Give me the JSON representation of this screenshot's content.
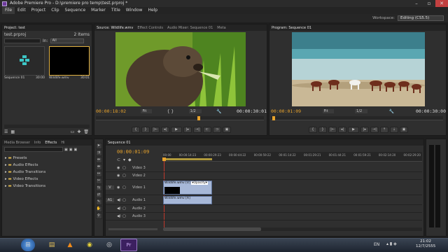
{
  "window": {
    "title": "Adobe Premiere Pro - D:\\premiere pro temp\\test.prproj *"
  },
  "menu": [
    "File",
    "Edit",
    "Project",
    "Clip",
    "Sequence",
    "Marker",
    "Title",
    "Window",
    "Help"
  ],
  "workspace": {
    "label": "Workspace:",
    "value": "Editing (CS5.5)"
  },
  "project_panel": {
    "tab": "Project: test",
    "file": "test.prproj",
    "count": "2 Items",
    "in_label": "In:",
    "in_value": "All",
    "items": [
      {
        "name": "Sequence 01",
        "duration": "30:00"
      },
      {
        "name": "Wildlife.wmv",
        "duration": "30:01"
      }
    ]
  },
  "source_monitor": {
    "tabs": [
      "Source: Wildlife.wmv",
      "Effect Controls",
      "Audio Mixer: Sequence 01",
      "Meta"
    ],
    "timecode_left": "00:00:18:02",
    "fit": "Fit",
    "ratio": "1/2",
    "timecode_right": "00:00:30:01"
  },
  "program_monitor": {
    "tab": "Program: Sequence 01",
    "timecode_left": "00:00:01:09",
    "fit": "Fit",
    "ratio": "1/2",
    "timecode_right": "00:00:30:00"
  },
  "effects_panel": {
    "tabs": [
      "Media Browser",
      "Info",
      "Effects",
      "Hi"
    ],
    "folders": [
      "Presets",
      "Audio Effects",
      "Audio Transitions",
      "Video Effects",
      "Video Transitions"
    ]
  },
  "timeline": {
    "tab": "Sequence 01",
    "timecode": "00:00:01:09",
    "ruler": [
      "00:00",
      "00:00:14:23",
      "00:00:29:23",
      "00:00:44:22",
      "00:00:59:22",
      "00:01:14:22",
      "00:01:29:21",
      "00:01:44:21",
      "00:01:59:21",
      "00:02:14:20",
      "00:02:29:20"
    ],
    "tracks": [
      {
        "patch": "",
        "name": "Video 3"
      },
      {
        "patch": "",
        "name": "Video 2"
      },
      {
        "patch": "V",
        "name": "Video 1"
      },
      {
        "patch": "A1",
        "name": "Audio 1"
      },
      {
        "patch": "",
        "name": "Audio 2"
      },
      {
        "patch": "",
        "name": "Audio 3"
      }
    ],
    "video_clip": "Wildlife.wmv [V]",
    "video_clip_fx": "Opacity",
    "audio_clip": "Wildlife.wmv [A]"
  },
  "taskbar": {
    "lang": "EN",
    "time": "21:02",
    "date": "12/7/2555",
    "premiere_label": "Pr"
  }
}
